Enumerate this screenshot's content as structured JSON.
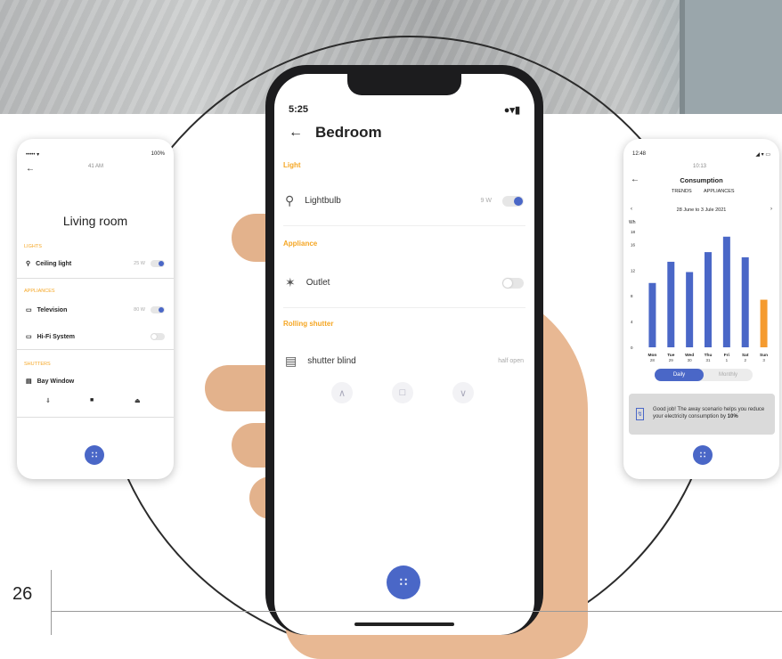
{
  "page_number": "26",
  "center_phone": {
    "time": "5:25",
    "status_icons": "●▾▮",
    "title": "Bedroom",
    "sections": {
      "light": "Light",
      "appliance": "Appliance",
      "shutters": "Rolling shutter"
    },
    "lightbulb": {
      "label": "Lightbulb",
      "value": "9 W",
      "on": true
    },
    "outlet": {
      "label": "Outlet",
      "on": false
    },
    "shutter": {
      "label": "shutter blind",
      "status": "half open"
    }
  },
  "left_phone": {
    "carrier": "••••• ▾",
    "time": "41 AM",
    "battery": "100%",
    "title": "Living room",
    "sections": {
      "lights": "LIGHTS",
      "appliances": "APPLIANCES",
      "shutters": "SHUTTERS"
    },
    "items": [
      {
        "label": "Ceiling light",
        "value": "25 W",
        "on": true
      },
      {
        "label": "Television",
        "value": "80 W",
        "on": true
      },
      {
        "label": "Hi-Fi System",
        "value": "",
        "on": false
      },
      {
        "label": "Bay Window"
      }
    ]
  },
  "right_phone": {
    "time": "12:48",
    "status_icons": "◢ ▾ ▭",
    "sub_time": "10:13",
    "title": "Consumption",
    "tabs": [
      "TRENDS",
      "APPLIANCES"
    ],
    "range": "28 June to 3 Jule 2021",
    "period_options": [
      "Daily",
      "Monthly"
    ],
    "message_prefix": "Good job! The away scenario helps you reduce your electricity consumption by ",
    "message_value": "10%"
  },
  "chart_data": {
    "type": "bar",
    "ylabel": "Wh",
    "ylim": [
      0,
      18
    ],
    "yticks": [
      0,
      4,
      8,
      12,
      16,
      18
    ],
    "categories": [
      "Mon",
      "Tue",
      "Wed",
      "Thu",
      "Fri",
      "Sat",
      "Sun"
    ],
    "dates": [
      "28",
      "29",
      "30",
      "31",
      "1",
      "2",
      "3"
    ],
    "values": [
      10,
      13.3,
      11.7,
      14.8,
      17.2,
      14,
      7.4
    ],
    "colors": [
      "#4a67c7",
      "#4a67c7",
      "#4a67c7",
      "#4a67c7",
      "#4a67c7",
      "#4a67c7",
      "#f59b2f"
    ]
  }
}
